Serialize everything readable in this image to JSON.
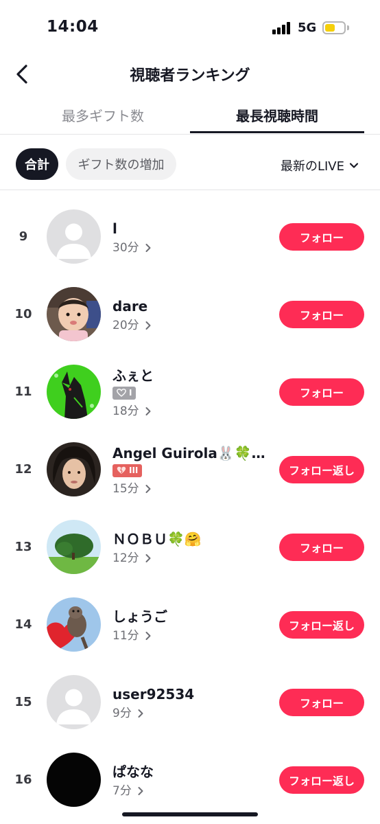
{
  "status_bar": {
    "time": "14:04",
    "network": "5G",
    "battery_level": 0.55,
    "battery_color": "#f5cf0a"
  },
  "header": {
    "title": "視聴者ランキング",
    "back_icon": "chevron-left-icon"
  },
  "tabs": [
    {
      "label": "最多ギフト数",
      "active": false
    },
    {
      "label": "最長視聴時間",
      "active": true
    }
  ],
  "filters": {
    "chips": [
      {
        "label": "合計",
        "selected": true
      },
      {
        "label": "ギフト数の増加",
        "selected": false
      }
    ],
    "dropdown": {
      "label": "最新のLIVE",
      "icon": "chevron-down-icon"
    }
  },
  "colors": {
    "accent": "#fe2c55",
    "text": "#161823",
    "muted": "#8a8b91"
  },
  "viewers": [
    {
      "rank": "9",
      "name": "l",
      "duration": "30分",
      "button": "フォロー",
      "avatar": "default-avatar",
      "badge": null
    },
    {
      "rank": "10",
      "name": "dare",
      "duration": "20分",
      "button": "フォロー",
      "avatar": "baby-photo",
      "badge": null
    },
    {
      "rank": "11",
      "name": "ふぇと",
      "duration": "18分",
      "button": "フォロー",
      "avatar": "green-wolf",
      "badge": {
        "level": "I",
        "color": "gray"
      }
    },
    {
      "rank": "12",
      "name": "Angel Guirola🐰🍀…",
      "duration": "15分",
      "button": "フォロー返し",
      "avatar": "curly-hair-photo",
      "badge": {
        "level": "III",
        "color": "red"
      }
    },
    {
      "rank": "13",
      "name": "ＮＯＢＵ🍀🤗",
      "duration": "12分",
      "button": "フォロー",
      "avatar": "tree-photo",
      "badge": null
    },
    {
      "rank": "14",
      "name": "しょうご",
      "duration": "11分",
      "button": "フォロー返し",
      "avatar": "otter-heart",
      "badge": null
    },
    {
      "rank": "15",
      "name": "user92534",
      "duration": "9分",
      "button": "フォロー",
      "avatar": "default-avatar",
      "badge": null
    },
    {
      "rank": "16",
      "name": "ぱなな",
      "duration": "7分",
      "button": "フォロー返し",
      "avatar": "black-circle",
      "badge": null
    }
  ]
}
